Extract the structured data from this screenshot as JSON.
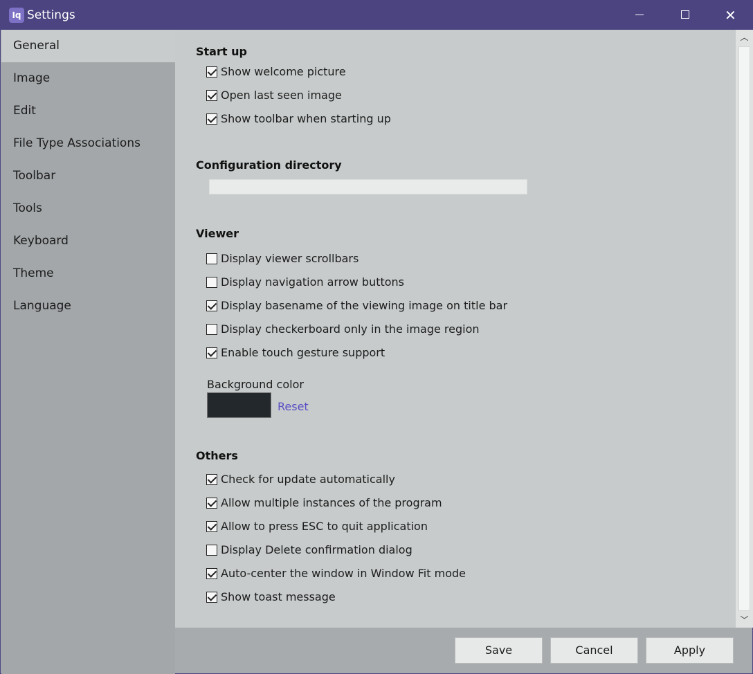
{
  "window": {
    "title": "Settings",
    "app_icon_glyph": "Iq"
  },
  "sidebar": {
    "items": [
      {
        "label": "General",
        "active": true
      },
      {
        "label": "Image"
      },
      {
        "label": "Edit"
      },
      {
        "label": "File Type Associations"
      },
      {
        "label": "Toolbar"
      },
      {
        "label": "Tools"
      },
      {
        "label": "Keyboard"
      },
      {
        "label": "Theme"
      },
      {
        "label": "Language"
      }
    ]
  },
  "startup": {
    "title": "Start up",
    "options": [
      {
        "label": "Show welcome picture",
        "checked": true
      },
      {
        "label": "Open last seen image",
        "checked": true
      },
      {
        "label": "Show toolbar when starting up",
        "checked": true
      }
    ]
  },
  "config": {
    "title": "Configuration directory",
    "value": ""
  },
  "viewer": {
    "title": "Viewer",
    "options": [
      {
        "label": "Display viewer scrollbars",
        "checked": false
      },
      {
        "label": "Display navigation arrow buttons",
        "checked": false
      },
      {
        "label": "Display basename of the viewing image on title bar",
        "checked": true
      },
      {
        "label": "Display checkerboard only in the image region",
        "checked": false
      },
      {
        "label": "Enable touch gesture support",
        "checked": true
      }
    ],
    "background_color_label": "Background color",
    "background_color": "#23282c",
    "reset_label": "Reset"
  },
  "others": {
    "title": "Others",
    "options": [
      {
        "label": "Check for update automatically",
        "checked": true
      },
      {
        "label": "Allow multiple instances of the program",
        "checked": true
      },
      {
        "label": "Allow to press ESC to quit application",
        "checked": true
      },
      {
        "label": "Display Delete confirmation dialog",
        "checked": false
      },
      {
        "label": "Auto-center the window in Window Fit mode",
        "checked": true
      },
      {
        "label": "Show toast message",
        "checked": true
      }
    ]
  },
  "footer": {
    "save_label": "Save",
    "cancel_label": "Cancel",
    "apply_label": "Apply"
  },
  "colors": {
    "titlebar": "#4b4480",
    "accent": "#5a4fc6",
    "content_bg": "#c7cbcb",
    "sidebar_bg": "#a3a7a9"
  }
}
